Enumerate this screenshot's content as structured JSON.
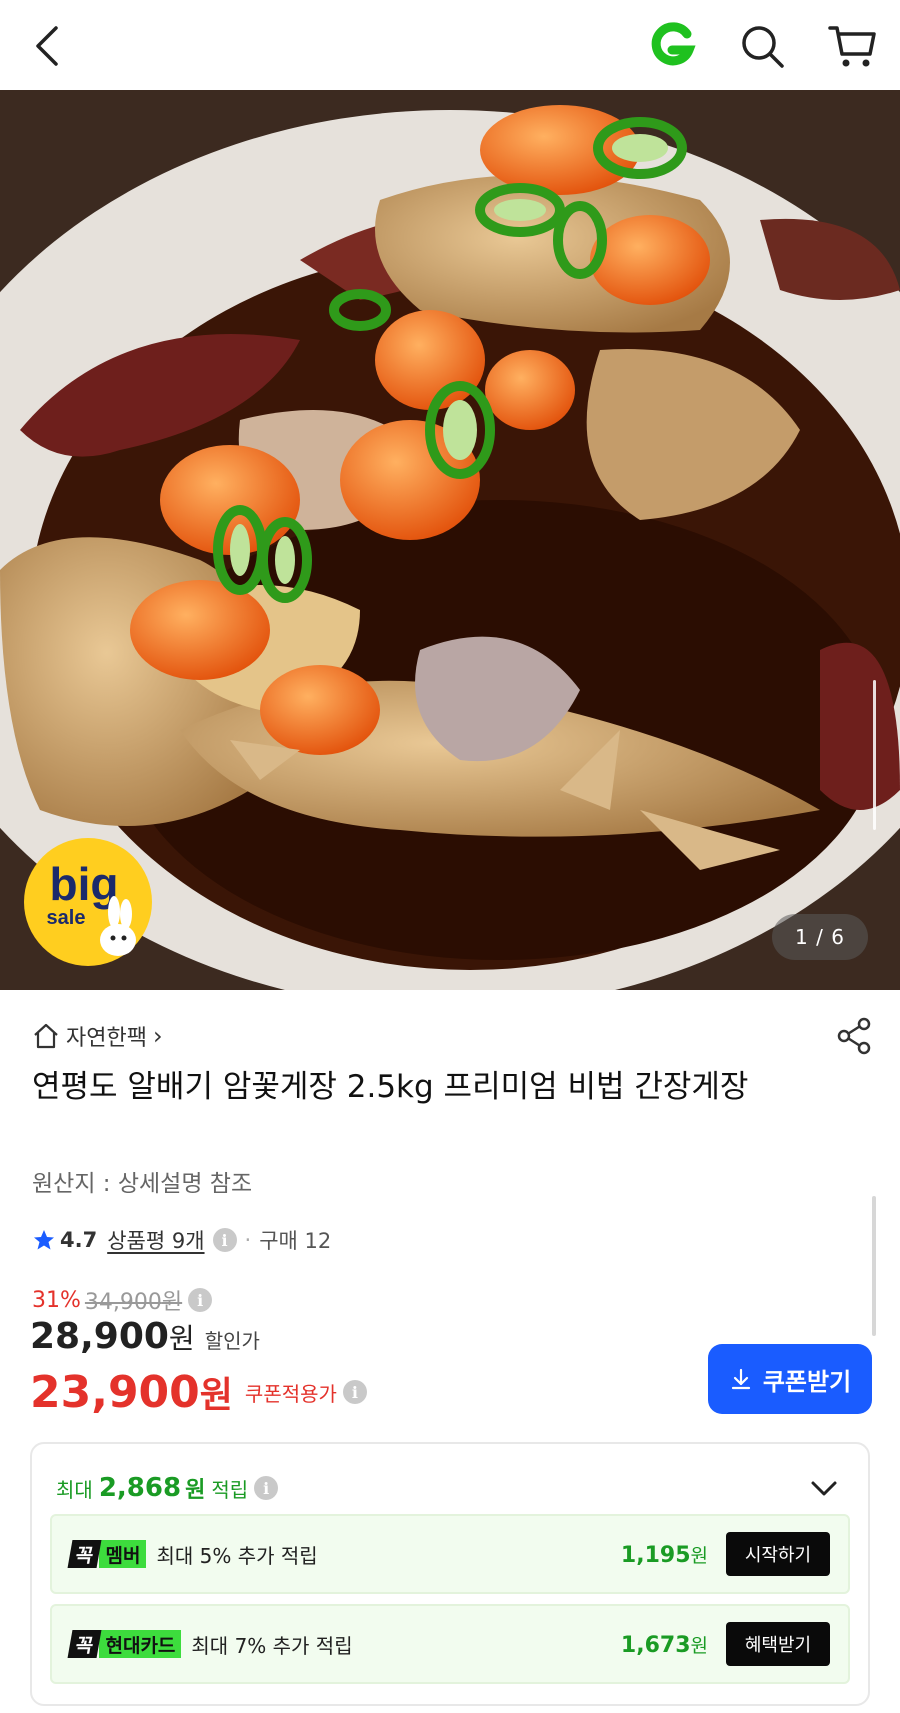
{
  "header": {
    "back_icon": "chevron-left-icon",
    "logo_icon": "g-logo-icon",
    "logo_color": "#1fc11f",
    "search_icon": "search-icon",
    "cart_icon": "cart-icon"
  },
  "gallery": {
    "counter": "1 / 6",
    "badge_big": "big",
    "badge_sale": "sale"
  },
  "product": {
    "brand": "자연한팩",
    "brand_chevron": "›",
    "title": "연평도 알배기 암꽃게장 2.5kg 프리미엄 비법 간장게장",
    "origin": "원산지 : 상세설명 참조",
    "rating": "4.7",
    "reviews": "상품평 9개",
    "dot": "·",
    "purchases": "구매 12"
  },
  "price": {
    "discount_pct": "31%",
    "original": "34,900",
    "original_unit": "원",
    "sale_amount": "28,900",
    "sale_unit": "원",
    "sale_label": "할인가",
    "coupon_amount": "23,900",
    "coupon_unit": "원",
    "coupon_label": "쿠폰적용가",
    "coupon_button": "쿠폰받기",
    "accent": "#e4322b",
    "button_color": "#1a5cff"
  },
  "reward": {
    "prefix": "최대",
    "amount": "2,868",
    "unit": "원",
    "suffix": "적립",
    "items": [
      {
        "badge_kk": "꼭",
        "badge_name": "멤버",
        "desc": "최대 5% 추가 적립",
        "amount": "1,195",
        "unit": "원",
        "action": "시작하기"
      },
      {
        "badge_kk": "꼭",
        "badge_name": "현대카드",
        "desc": "최대 7% 추가 적립",
        "amount": "1,673",
        "unit": "원",
        "action": "혜택받기"
      }
    ],
    "accent": "#1a9b24"
  },
  "info_glyph": "i"
}
